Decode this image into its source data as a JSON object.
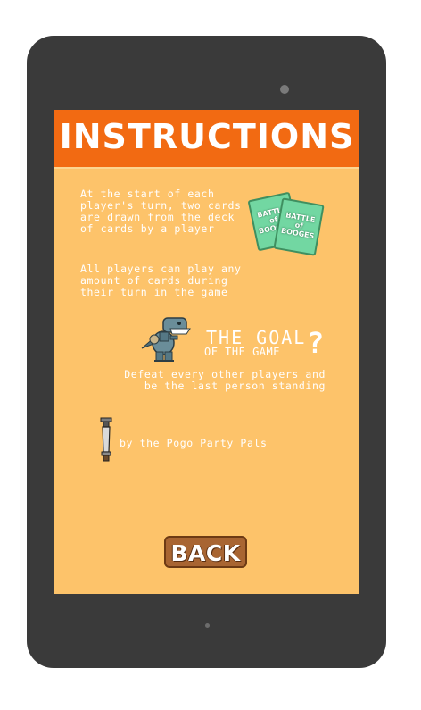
{
  "header": {
    "title": "INSTRUCTIONS"
  },
  "instructions": {
    "paragraph_1": "At the start of each player's turn, two cards are drawn from the deck of cards by a player",
    "paragraph_2": "All players can play any amount of cards during their turn in the game"
  },
  "cards_icon": {
    "name": "cards-icon",
    "card_title": "BATTLE of BOOGES"
  },
  "goal": {
    "title": "THE GOAL",
    "subtitle": "OF THE GAME",
    "question_mark": "?",
    "description": "Defeat every other players and be the last person standing"
  },
  "credits": {
    "text": "by the Pogo Party Pals"
  },
  "back_button": {
    "label": "BACK"
  },
  "colors": {
    "header_bg": "#f26a12",
    "screen_bg": "#fdc36a",
    "device_bezel": "#3a3a3a",
    "button_bg": "#a86532",
    "card_bg": "#72d7a2"
  }
}
